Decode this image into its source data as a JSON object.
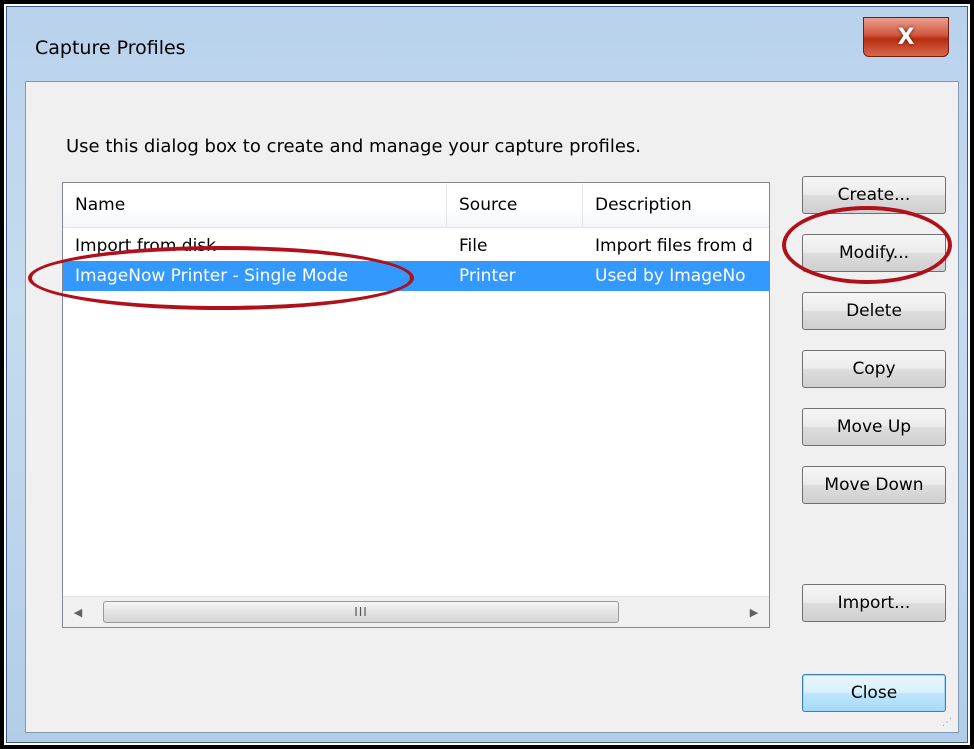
{
  "window": {
    "title": "Capture Profiles",
    "close_glyph": "X"
  },
  "instruction": "Use this dialog box to create and manage your capture profiles.",
  "list": {
    "columns": [
      "Name",
      "Source",
      "Description"
    ],
    "rows": [
      {
        "name": "Import from disk",
        "source": "File",
        "description": "Import files from d"
      },
      {
        "name": "ImageNow Printer - Single Mode",
        "source": "Printer",
        "description": "Used by ImageNo",
        "selected": true
      }
    ],
    "scroll_grip": "III"
  },
  "buttons": {
    "create": "Create...",
    "modify": "Modify...",
    "delete": "Delete",
    "copy": "Copy",
    "move_up": "Move Up",
    "move_down": "Move Down",
    "import": "Import...",
    "close": "Close"
  },
  "colors": {
    "selection": "#3399ff",
    "annotation": "#b0101a",
    "close_button": "#c2402a"
  },
  "icons": {
    "close": "close-icon",
    "scroll_left": "scroll-left-arrow-icon",
    "scroll_right": "scroll-right-arrow-icon",
    "resize_grip": "resize-grip-icon"
  }
}
